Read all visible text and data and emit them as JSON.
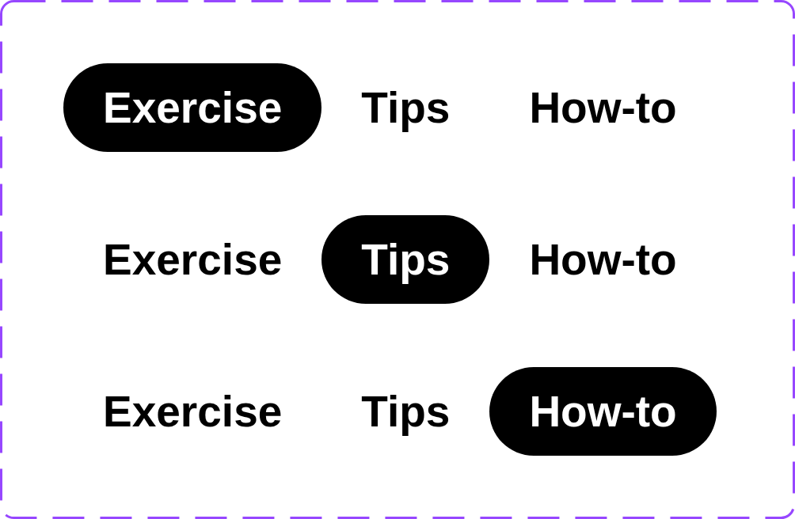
{
  "tab_rows": [
    {
      "tabs": [
        {
          "label": "Exercise",
          "selected": true
        },
        {
          "label": "Tips",
          "selected": false
        },
        {
          "label": "How-to",
          "selected": false
        }
      ]
    },
    {
      "tabs": [
        {
          "label": "Exercise",
          "selected": false
        },
        {
          "label": "Tips",
          "selected": true
        },
        {
          "label": "How-to",
          "selected": false
        }
      ]
    },
    {
      "tabs": [
        {
          "label": "Exercise",
          "selected": false
        },
        {
          "label": "Tips",
          "selected": false
        },
        {
          "label": "How-to",
          "selected": true
        }
      ]
    }
  ]
}
